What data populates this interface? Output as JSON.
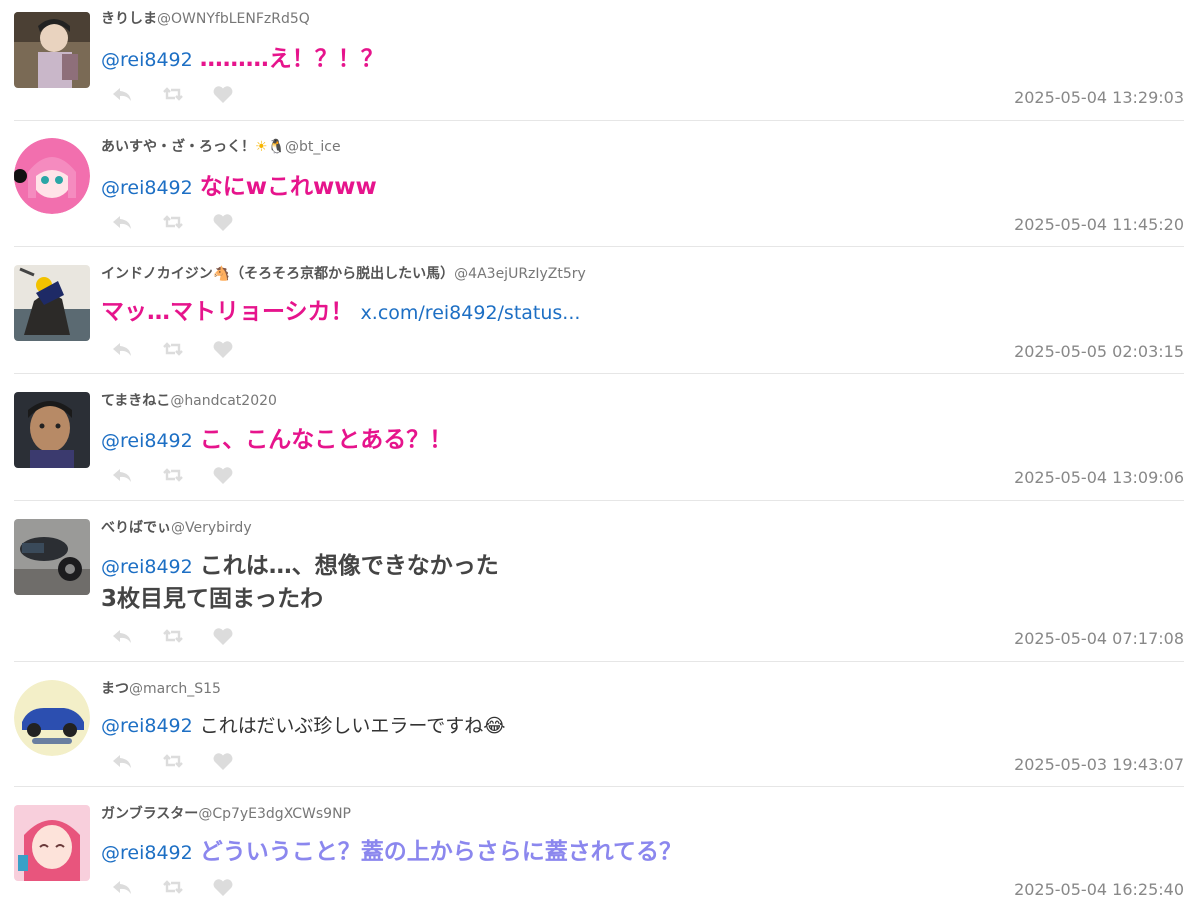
{
  "colors": {
    "mention": "#1d6fc4",
    "pink_text": "#e6148c",
    "violet_text": "#8b87ee",
    "timestamp": "#888888",
    "action_icon": "#dcdcdc"
  },
  "icons": [
    "reply-icon",
    "retweet-icon",
    "like-icon",
    "sun-emoji-icon",
    "penguin-emoji-icon",
    "horse-emoji-icon",
    "laughing-emoji-icon"
  ],
  "tweets": [
    {
      "display_name": "きりしま",
      "handle": "@OWNYfbLENFzRd5Q",
      "mention": "@rei8492",
      "text": "………え！？！？",
      "timestamp": "2025-05-04 13:29:03"
    },
    {
      "display_name": "あいすや・ざ・ろっく！",
      "handle": "@bt_ice",
      "mention": "@rei8492",
      "text": "なにwこれwww",
      "timestamp": "2025-05-04 11:45:20"
    },
    {
      "display_name": "インドノカイジン",
      "display_name_suffix": "（そろそろ京都から脱出したい馬）",
      "handle": "@4A3ejURzIyZt5ry",
      "text": "マッ…マトリョーシカ！",
      "link": "x.com/rei8492/status...",
      "timestamp": "2025-05-05 02:03:15"
    },
    {
      "display_name": "てまきねこ",
      "handle": "@handcat2020",
      "mention": "@rei8492",
      "text": "こ、こんなことある？！",
      "timestamp": "2025-05-04 13:09:06"
    },
    {
      "display_name": "べりばでぃ",
      "handle": "@Verybirdy",
      "mention": "@rei8492",
      "text": "これは…、想像できなかった",
      "text_line2": "3枚目見て固まったわ",
      "timestamp": "2025-05-04 07:17:08"
    },
    {
      "display_name": "まつ",
      "handle": "@march_S15",
      "mention": "@rei8492",
      "text": "これはだいぶ珍しいエラーですね",
      "timestamp": "2025-05-03 19:43:07"
    },
    {
      "display_name": "ガンブラスター",
      "handle": "@Cp7yE3dgXCWs9NP",
      "mention": "@rei8492",
      "text": "どういうこと？蓋の上からさらに蓋されてる？",
      "timestamp": "2025-05-04 16:25:40"
    }
  ]
}
